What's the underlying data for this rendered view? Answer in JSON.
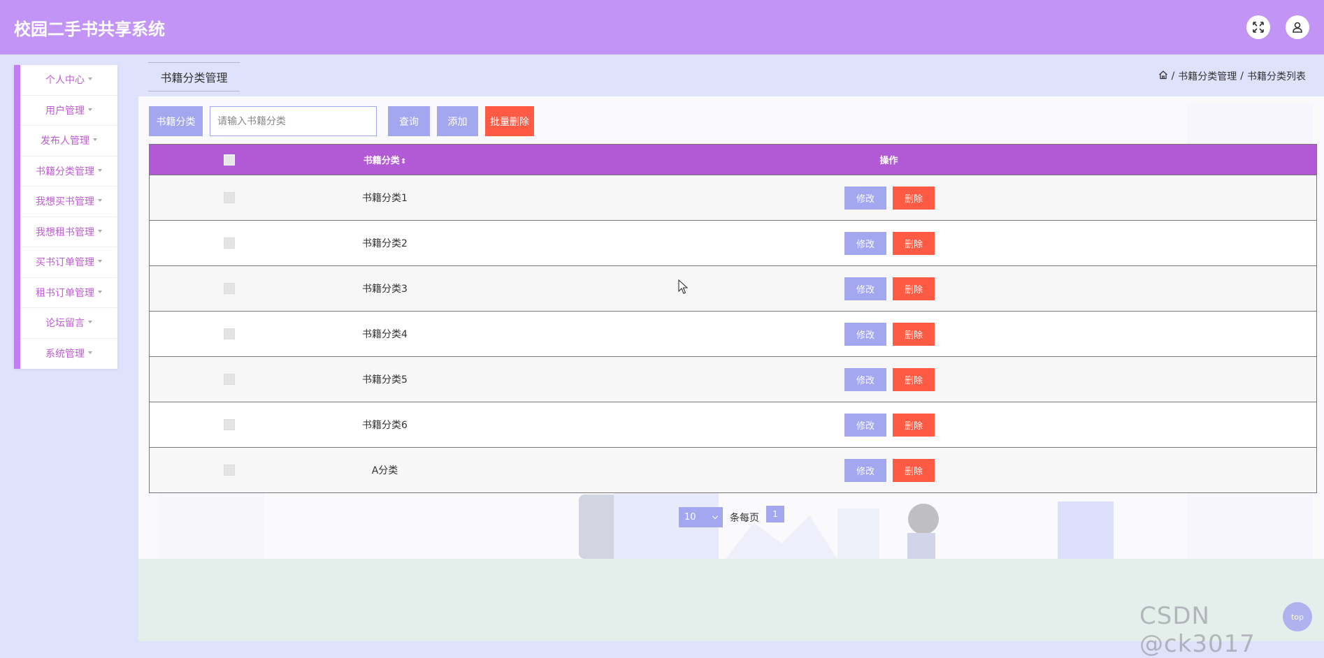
{
  "header": {
    "title": "校园二手书共享系统",
    "fullscreen_icon": "fullscreen-icon",
    "user_icon": "user-icon"
  },
  "sidebar": {
    "items": [
      {
        "label": "个人中心"
      },
      {
        "label": "用户管理"
      },
      {
        "label": "发布人管理"
      },
      {
        "label": "书籍分类管理"
      },
      {
        "label": "我想买书管理"
      },
      {
        "label": "我想租书管理"
      },
      {
        "label": "买书订单管理"
      },
      {
        "label": "租书订单管理"
      },
      {
        "label": "论坛留言"
      },
      {
        "label": "系统管理"
      }
    ]
  },
  "page": {
    "tab_label": "书籍分类管理",
    "breadcrumb": {
      "sep": "/",
      "level1": "书籍分类管理",
      "level2": "书籍分类列表"
    }
  },
  "search": {
    "label": "书籍分类",
    "placeholder": "请输入书籍分类",
    "value": "",
    "query_label": "查询",
    "add_label": "添加",
    "batch_delete_label": "批量删除"
  },
  "table": {
    "headers": {
      "name": "书籍分类",
      "sort_glyph": "⇕",
      "ops": "操作"
    },
    "edit_label": "修改",
    "delete_label": "删除",
    "rows": [
      {
        "name": "书籍分类1"
      },
      {
        "name": "书籍分类2"
      },
      {
        "name": "书籍分类3"
      },
      {
        "name": "书籍分类4"
      },
      {
        "name": "书籍分类5"
      },
      {
        "name": "书籍分类6"
      },
      {
        "name": "A分类"
      }
    ]
  },
  "pagination": {
    "page_size": "10",
    "per_page_label": "条每页",
    "current_page": "1"
  },
  "watermark": "CSDN @ck3017",
  "back_to_top": "top",
  "colors": {
    "header": "#c194f5",
    "accent": "#a3a7f0",
    "danger": "#ff5a43",
    "table_header": "#b25ad6",
    "sidebar_text": "#c05bd6"
  }
}
